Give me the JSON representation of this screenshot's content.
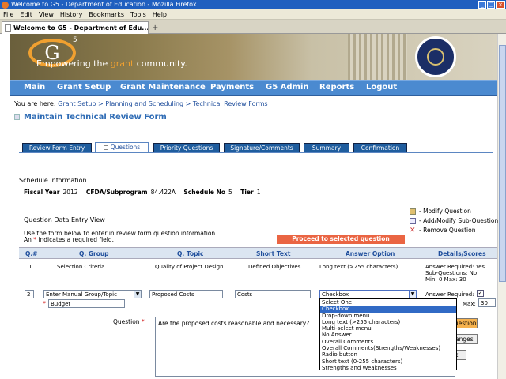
{
  "window": {
    "title": "Welcome to G5 - Department of Education - Mozilla Firefox"
  },
  "menu": [
    "File",
    "Edit",
    "View",
    "History",
    "Bookmarks",
    "Tools",
    "Help"
  ],
  "browser_tab": {
    "label": "Welcome to G5 - Department of Edu..."
  },
  "banner": {
    "logo": "G",
    "logo_sup": "5",
    "tagline_pre": "Empowering the ",
    "tagline_accent": "grant",
    "tagline_post": " community."
  },
  "nav": [
    "Main",
    "Grant Setup",
    "Grant Maintenance",
    "Payments",
    "G5 Admin",
    "Reports",
    "Logout"
  ],
  "breadcrumb": {
    "prefix": "You are here: ",
    "path": "Grant Setup > Planning and Scheduling > Technical Review Forms"
  },
  "page_title": "Maintain Technical Review Form",
  "form_tabs": [
    "Review Form Entry",
    "Questions",
    "Priority Questions",
    "Signature/Comments",
    "Summary",
    "Confirmation"
  ],
  "schedule": {
    "heading": "Schedule Information",
    "fiscal_year_label": "Fiscal Year",
    "fiscal_year": "2012",
    "cfda_label": "CFDA/Subprogram",
    "cfda": "84.422A",
    "schedule_label": "Schedule No",
    "schedule_no": "5",
    "tier_label": "Tier",
    "tier": "1"
  },
  "question_entry": {
    "heading": "Question Data Entry View",
    "instr1": "Use the form below to enter in review form question information.",
    "instr2_pre": "An ",
    "instr2_star": "*",
    "instr2_post": " indicates a required field.",
    "proceed": "Proceed to selected question"
  },
  "legend": {
    "modify": "- Modify Question",
    "add_sub": "- Add/Modify Sub-Question",
    "remove": "- Remove Question"
  },
  "table": {
    "headers": [
      "Q.#",
      "Q. Group",
      "Q. Topic",
      "Short Text",
      "Answer Option",
      "Details/Scores"
    ],
    "row1": {
      "num": "1",
      "group": "Selection Criteria",
      "topic": "Quality of Project Design",
      "short": "Defined Objectives",
      "answer": "Long text (>255 characters)",
      "d1": "Answer Required: Yes",
      "d2": "Sub-Questions: No",
      "d3": "Min: 0 Max: 30"
    },
    "edit": {
      "num": "2",
      "group": "Enter Manual Group/Topic",
      "sub_group": "Budget",
      "topic": "Proposed Costs",
      "short": "Costs",
      "answer": "Checkbox",
      "answer_required_label": "Answer Required:",
      "answer_required_check": "✓",
      "max_label": "Max:",
      "max_value": "30"
    }
  },
  "dropdown_options": [
    "Select One",
    "Checkbox",
    "Drop-down menu",
    "Long text (>255 characters)",
    "Multi-select menu",
    "No Answer",
    "Overall Comments",
    "Overall Comments(Strengths/Weaknesses)",
    "Radio button",
    "Short text (0-255 characters)",
    "Strengths and Weaknesses"
  ],
  "question": {
    "label": "Question",
    "star": "*",
    "text": "Are the proposed costs reasonable and necessary?"
  },
  "side_buttons": {
    "question": "Question",
    "changes": "Changes",
    "back": "ck"
  }
}
